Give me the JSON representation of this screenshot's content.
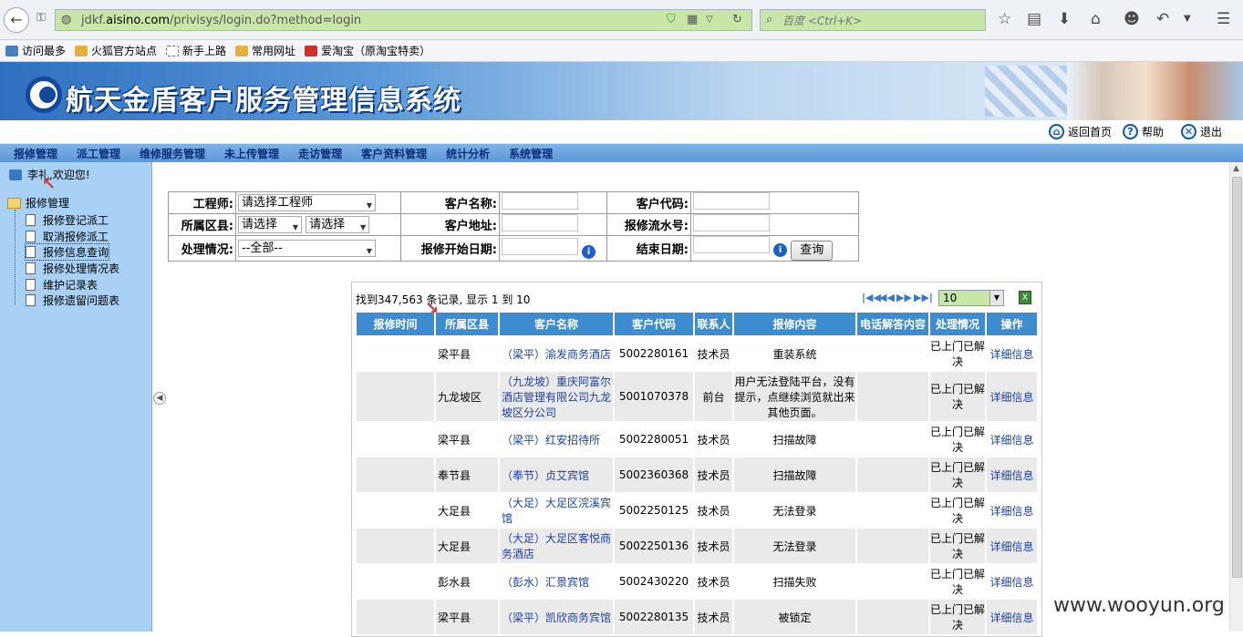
{
  "browser": {
    "url_path_pre": "jdkf.",
    "url_host": "aisino.com",
    "url_path": "/privisys/login.do?method=login",
    "search_placeholder": "百度 <Ctrl+K>"
  },
  "bookmarks": [
    {
      "label": "访问最多",
      "color": "#4c7fc0"
    },
    {
      "label": "火狐官方站点",
      "color": "#e3b23c"
    },
    {
      "label": "新手上路",
      "color": "#ffffff"
    },
    {
      "label": "常用网址",
      "color": "#e3b23c"
    },
    {
      "label": "爱淘宝（原淘宝特卖）",
      "color": "#d0312d"
    }
  ],
  "banner": {
    "title": "航天金盾客户服务管理信息系统"
  },
  "util": {
    "home": "返回首页",
    "help": "帮助",
    "logout": "退出"
  },
  "menu": [
    "报修管理",
    "派工管理",
    "维修服务管理",
    "未上传管理",
    "走访管理",
    "客户资料管理",
    "统计分析",
    "系统管理"
  ],
  "sidebar": {
    "welcome": "李礼,欢迎您!",
    "root": "报修管理",
    "items": [
      "报修登记派工",
      "取消报修派工",
      "报修信息查询",
      "报修处理情况表",
      "维护记录表",
      "报修遗留问题表"
    ]
  },
  "form": {
    "engineer_label": "工程师:",
    "engineer_value": "请选择工程师",
    "customer_name_label": "客户名称:",
    "customer_code_label": "客户代码:",
    "district_label": "所属区县:",
    "district_value1": "请选择",
    "district_value2": "请选择",
    "address_label": "客户地址:",
    "serial_label": "报修流水号:",
    "status_label": "处理情况:",
    "status_value": "--全部--",
    "start_label": "报修开始日期:",
    "end_label": "结束日期:",
    "query_button": "查询"
  },
  "result": {
    "found_text": "找到347,563 条记录, 显示 1 到 10",
    "page_size": "10",
    "columns": [
      "报修时间",
      "所属区县",
      "客户名称",
      "客户代码",
      "联系人",
      "报修内容",
      "电话解答内容",
      "处理情况",
      "操作"
    ],
    "rows": [
      {
        "time": "",
        "district": "梁平县",
        "name": "（梁平）渝发商务酒店",
        "code": "5002280161",
        "contact": "技术员",
        "content": "重装系统",
        "phone": "",
        "status": "已上门已解决",
        "op": "详细信息"
      },
      {
        "time": "",
        "district": "九龙坡区",
        "name": "（九龙坡）重庆阿富尔酒店管理有限公司九龙坡区分公司",
        "code": "5001070378",
        "contact": "前台",
        "content": "用户无法登陆平台，没有提示，点继续浏览就出来其他页面。",
        "phone": "",
        "status": "已上门已解决",
        "op": "详细信息"
      },
      {
        "time": "",
        "district": "梁平县",
        "name": "（梁平）红安招待所",
        "code": "5002280051",
        "contact": "技术员",
        "content": "扫描故障",
        "phone": "",
        "status": "已上门已解决",
        "op": "详细信息"
      },
      {
        "time": "",
        "district": "奉节县",
        "name": "（奉节）贞艾宾馆",
        "code": "5002360368",
        "contact": "技术员",
        "content": "扫描故障",
        "phone": "",
        "status": "已上门已解决",
        "op": "详细信息"
      },
      {
        "time": "",
        "district": "大足县",
        "name": "（大足）大足区浣溪宾馆",
        "code": "5002250125",
        "contact": "技术员",
        "content": "无法登录",
        "phone": "",
        "status": "已上门已解决",
        "op": "详细信息"
      },
      {
        "time": "",
        "district": "大足县",
        "name": "（大足）大足区客悦商务酒店",
        "code": "5002250136",
        "contact": "技术员",
        "content": "无法登录",
        "phone": "",
        "status": "已上门已解决",
        "op": "详细信息"
      },
      {
        "time": "",
        "district": "彭水县",
        "name": "（彭水）汇景宾馆",
        "code": "5002430220",
        "contact": "技术员",
        "content": "扫描失败",
        "phone": "",
        "status": "已上门已解决",
        "op": "详细信息"
      },
      {
        "time": "",
        "district": "梁平县",
        "name": "（梁平）凯欣商务宾馆",
        "code": "5002280135",
        "contact": "技术员",
        "content": "被锁定",
        "phone": "",
        "status": "已上门已解决",
        "op": "详细信息"
      }
    ]
  },
  "watermark": "www.wooyun.org"
}
